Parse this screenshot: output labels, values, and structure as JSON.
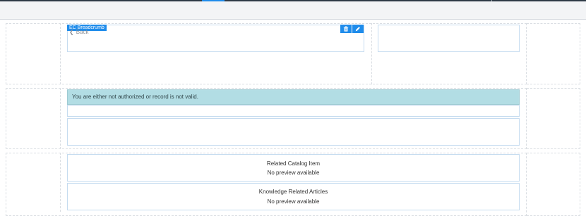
{
  "widget": {
    "badge_label": "EC Breadcrumb",
    "back_label": "Back"
  },
  "alert": {
    "message": "You are either not authorized or record is not valid."
  },
  "related_catalog": {
    "title": "Related Catalog Item",
    "empty": "No preview available"
  },
  "knowledge": {
    "title": "Knowledge Related Articles",
    "empty": "No preview available"
  },
  "icons": {
    "delete": "trash-icon",
    "edit": "pencil-icon",
    "back": "chevron-left-icon"
  },
  "colors": {
    "accent": "#1f8ceb",
    "alert_bg": "#b2dde4"
  }
}
